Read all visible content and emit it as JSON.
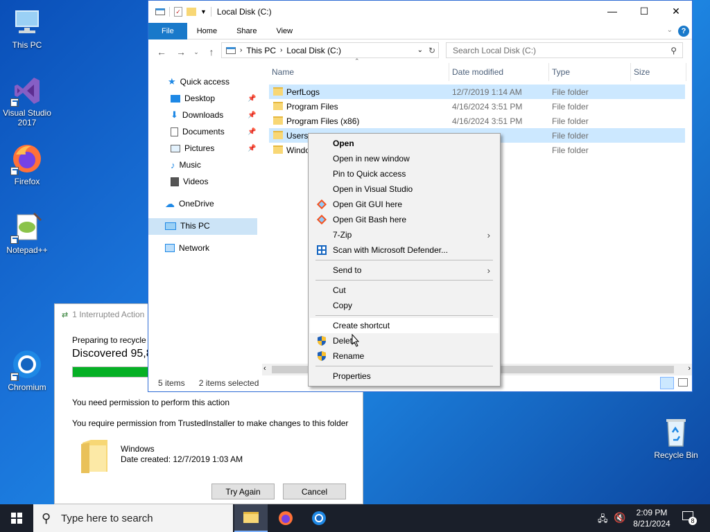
{
  "desktop": {
    "icons": [
      {
        "label": "This PC"
      },
      {
        "label": "Visual Studio 2017"
      },
      {
        "label": "Firefox"
      },
      {
        "label": "Notepad++"
      },
      {
        "label": "Chromium"
      },
      {
        "label": "Recycle Bin"
      }
    ]
  },
  "explorer": {
    "title": "Local Disk (C:)",
    "ribbon_tabs": [
      "File",
      "Home",
      "Share",
      "View"
    ],
    "breadcrumb": [
      "This PC",
      "Local Disk (C:)"
    ],
    "search_placeholder": "Search Local Disk (C:)",
    "nav": {
      "quick_access": "Quick access",
      "desktop": "Desktop",
      "downloads": "Downloads",
      "documents": "Documents",
      "pictures": "Pictures",
      "music": "Music",
      "videos": "Videos",
      "onedrive": "OneDrive",
      "this_pc": "This PC",
      "network": "Network"
    },
    "columns": [
      "Name",
      "Date modified",
      "Type",
      "Size"
    ],
    "rows": [
      {
        "name": "PerfLogs",
        "date": "12/7/2019 1:14 AM",
        "type": "File folder",
        "selected": true
      },
      {
        "name": "Program Files",
        "date": "4/16/2024 3:51 PM",
        "type": "File folder",
        "selected": false
      },
      {
        "name": "Program Files (x86)",
        "date": "4/16/2024 3:51 PM",
        "type": "File folder",
        "selected": false
      },
      {
        "name": "Users",
        "date": "",
        "type": "File folder",
        "selected": true
      },
      {
        "name": "Windo",
        "date": "4 PM",
        "type": "File folder",
        "selected": false
      }
    ],
    "status": {
      "items": "5 items",
      "selected": "2 items selected"
    }
  },
  "context_menu": {
    "items": [
      "Open",
      "Open in new window",
      "Pin to Quick access",
      "Open in Visual Studio",
      "Open Git GUI here",
      "Open Git Bash here",
      "7-Zip",
      "Scan with Microsoft Defender...",
      "Send to",
      "Cut",
      "Copy",
      "Create shortcut",
      "Delete",
      "Rename",
      "Properties"
    ]
  },
  "dialog": {
    "title": "1 Interrupted Action",
    "preparing": "Preparing to recycle",
    "discovered": "Discovered 95,8",
    "progress": 0.58,
    "permission": "You need permission to perform this action",
    "requires": "You require permission from TrustedInstaller to make changes to this folder",
    "folder_name": "Windows",
    "date_created": "Date created: 12/7/2019 1:03 AM",
    "try_again": "Try Again",
    "cancel": "Cancel"
  },
  "taskbar": {
    "search_placeholder": "Type here to search",
    "time": "2:09 PM",
    "date": "8/21/2024",
    "notification_count": "8"
  }
}
